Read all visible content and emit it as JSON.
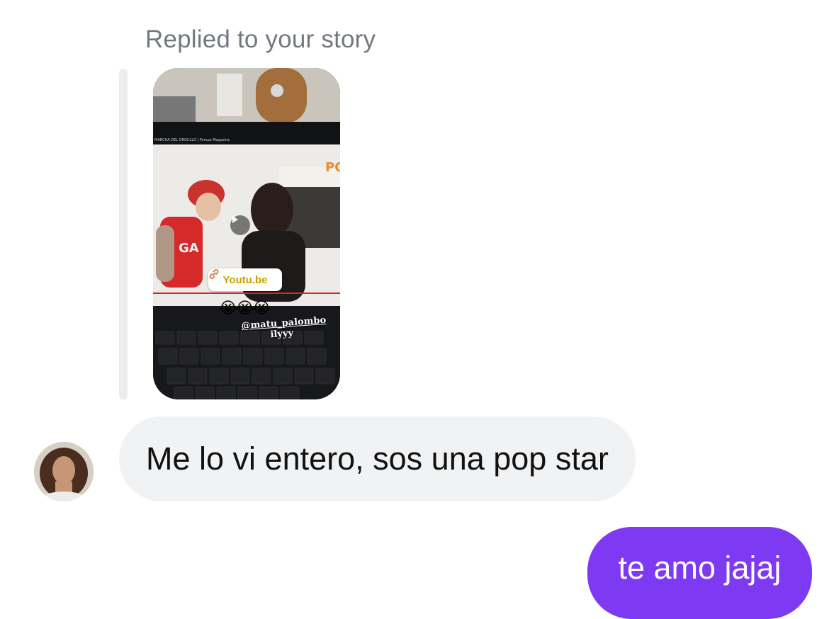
{
  "thread": {
    "reply_label": "Replied to your story",
    "story": {
      "link_sticker_text": "Youtu.be",
      "emojis": "😭😭😭",
      "mention": "@matu_palombo",
      "caption": "ilyyy",
      "screen_title": "MARCHA DEL ORGULLO | Pompa Magazine"
    },
    "incoming_message": "Me lo vi entero, sos una pop star",
    "outgoing_message": "te amo jajaj"
  },
  "colors": {
    "outgoing_bubble": "#7e3af2",
    "incoming_bubble": "#f1f2f4",
    "label": "#737780"
  }
}
